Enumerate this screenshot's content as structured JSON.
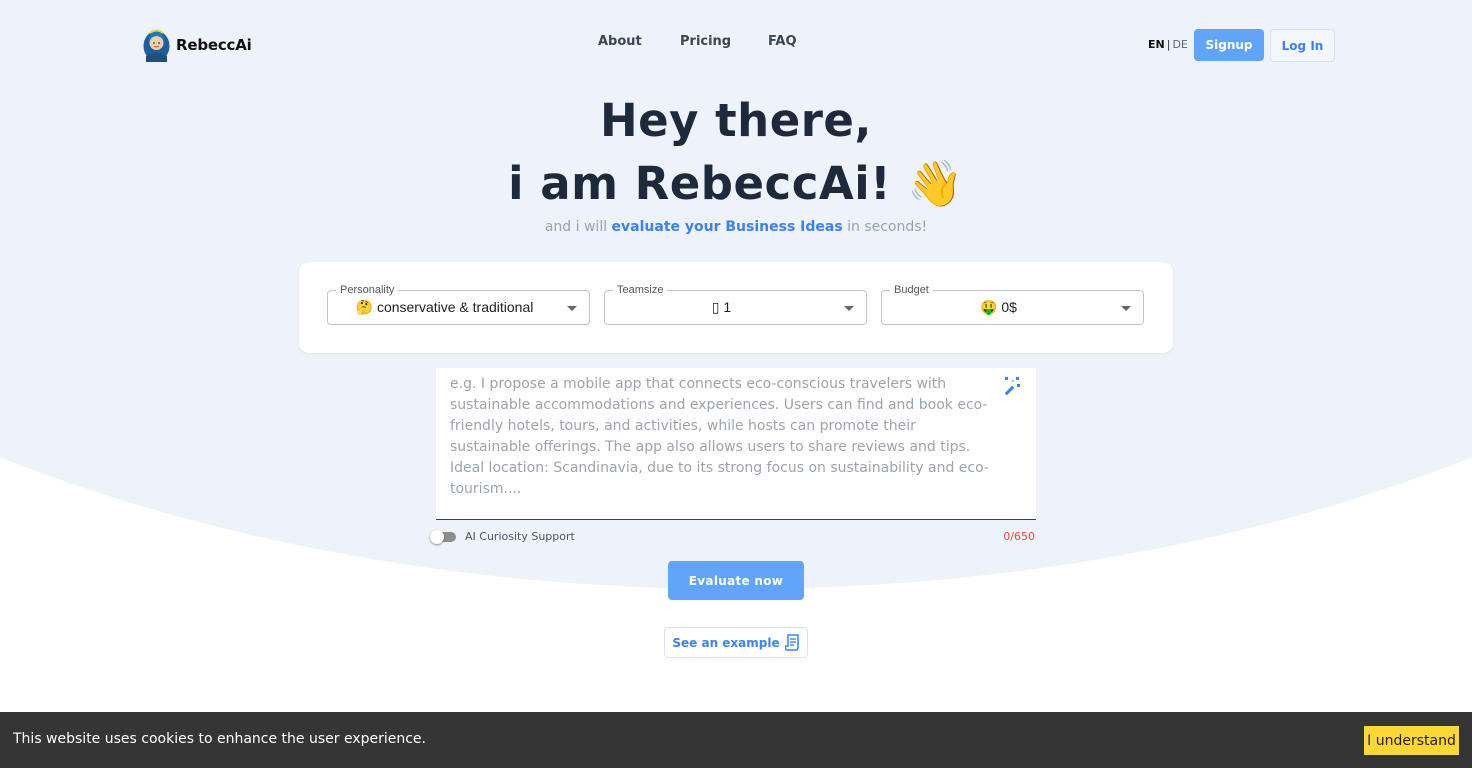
{
  "header": {
    "brand": "RebeccAi",
    "nav": [
      {
        "label": "About"
      },
      {
        "label": "Pricing"
      },
      {
        "label": "FAQ"
      }
    ],
    "language": {
      "active": "EN",
      "separator": "|",
      "other": "DE"
    },
    "signup_label": "Signup",
    "login_label": "Log In"
  },
  "hero": {
    "line1": "Hey there,",
    "line2": "i am RebeccAi! 👋",
    "sub_pre": "and i will ",
    "sub_bold": "evaluate your Business Ideas",
    "sub_post": " in seconds!"
  },
  "selectors": {
    "personality": {
      "label": "Personality",
      "value": "🤔 conservative & traditional"
    },
    "teamsize": {
      "label": "Teamsize",
      "value": "▯ 1"
    },
    "budget": {
      "label": "Budget",
      "value": "🤑 0$"
    }
  },
  "idea_input": {
    "value": "",
    "placeholder": "e.g. I propose a mobile app that connects eco-conscious travelers with sustainable accommodations and experiences. Users can find and book eco-friendly hotels, tours, and activities, while hosts can promote their sustainable offerings. The app also allows users to share reviews and tips. Ideal location: Scandinavia, due to its strong focus on sustainability and eco-tourism....",
    "magic_icon": "magic-wand-icon"
  },
  "curiosity": {
    "label": "AI Curiosity Support",
    "enabled": false
  },
  "char_counter": "0/650",
  "evaluate_label": "Evaluate now",
  "example_label": "See an example",
  "cookie": {
    "text": "This website uses cookies to enhance the user experience.",
    "button": "I understand"
  },
  "colors": {
    "accent": "#60a5fa",
    "link": "#3b82f6",
    "heading": "#1e293b",
    "background": "#eef2f9",
    "counter": "#ef4444",
    "cookie_bg": "#353535",
    "cookie_btn": "#fdd835"
  }
}
